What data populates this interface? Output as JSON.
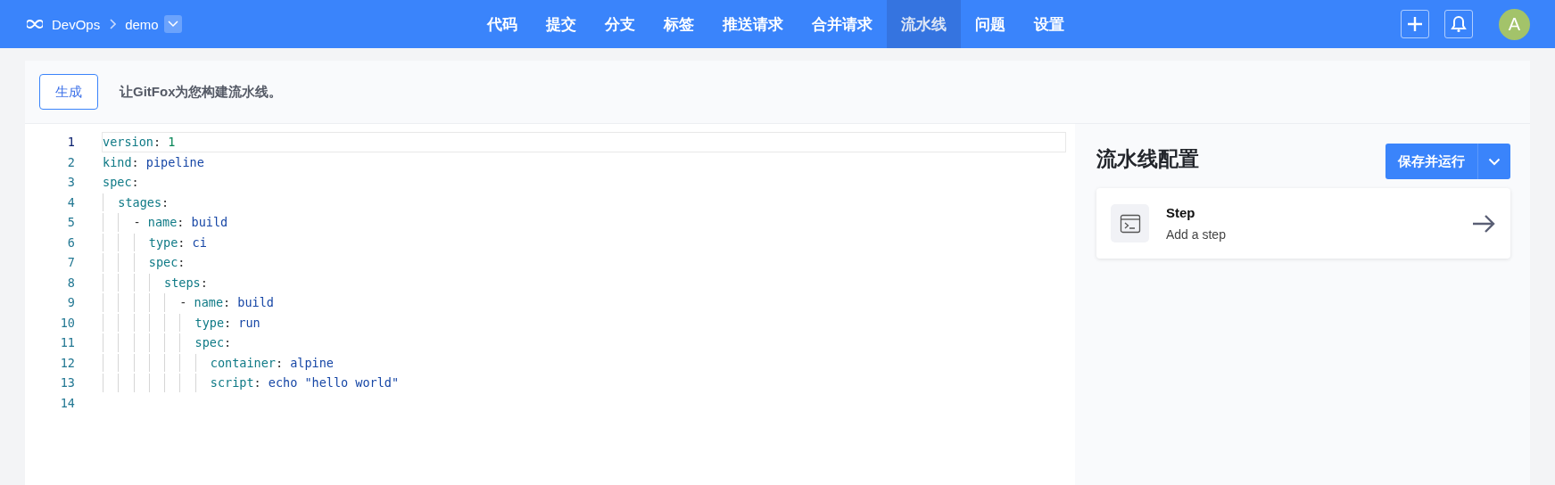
{
  "header": {
    "org": "DevOps",
    "repo": "demo",
    "nav": [
      {
        "label": "代码",
        "selected": false
      },
      {
        "label": "提交",
        "selected": false
      },
      {
        "label": "分支",
        "selected": false
      },
      {
        "label": "标签",
        "selected": false
      },
      {
        "label": "推送请求",
        "selected": false
      },
      {
        "label": "合并请求",
        "selected": false
      },
      {
        "label": "流水线",
        "selected": true
      },
      {
        "label": "问题",
        "selected": false
      },
      {
        "label": "设置",
        "selected": false
      }
    ],
    "avatar": "A"
  },
  "toolbar": {
    "button": "生成",
    "hint": "让GitFox为您构建流水线。"
  },
  "editor": {
    "lines": [
      {
        "number": "1",
        "active": true,
        "tokens": [
          {
            "kind": "key",
            "text": "version"
          },
          {
            "kind": "punct",
            "text": ": "
          },
          {
            "kind": "number",
            "text": "1"
          }
        ]
      },
      {
        "number": "2",
        "active": false,
        "tokens": [
          {
            "kind": "key",
            "text": "kind"
          },
          {
            "kind": "punct",
            "text": ": "
          },
          {
            "kind": "string",
            "text": "pipeline"
          }
        ]
      },
      {
        "number": "3",
        "active": false,
        "tokens": [
          {
            "kind": "key",
            "text": "spec"
          },
          {
            "kind": "punct",
            "text": ":"
          }
        ]
      },
      {
        "number": "4",
        "active": false,
        "tokens": [
          {
            "kind": "key",
            "text": "  stages"
          },
          {
            "kind": "punct",
            "text": ":"
          }
        ]
      },
      {
        "number": "5",
        "active": false,
        "tokens": [
          {
            "kind": "punct",
            "text": "    - "
          },
          {
            "kind": "key",
            "text": "name"
          },
          {
            "kind": "punct",
            "text": ": "
          },
          {
            "kind": "string",
            "text": "build"
          }
        ]
      },
      {
        "number": "6",
        "active": false,
        "tokens": [
          {
            "kind": "key",
            "text": "      type"
          },
          {
            "kind": "punct",
            "text": ": "
          },
          {
            "kind": "string",
            "text": "ci"
          }
        ]
      },
      {
        "number": "7",
        "active": false,
        "tokens": [
          {
            "kind": "key",
            "text": "      spec"
          },
          {
            "kind": "punct",
            "text": ":"
          }
        ]
      },
      {
        "number": "8",
        "active": false,
        "tokens": [
          {
            "kind": "key",
            "text": "        steps"
          },
          {
            "kind": "punct",
            "text": ":"
          }
        ]
      },
      {
        "number": "9",
        "active": false,
        "tokens": [
          {
            "kind": "punct",
            "text": "          - "
          },
          {
            "kind": "key",
            "text": "name"
          },
          {
            "kind": "punct",
            "text": ": "
          },
          {
            "kind": "string",
            "text": "build"
          }
        ]
      },
      {
        "number": "10",
        "active": false,
        "tokens": [
          {
            "kind": "key",
            "text": "            type"
          },
          {
            "kind": "punct",
            "text": ": "
          },
          {
            "kind": "string",
            "text": "run"
          }
        ]
      },
      {
        "number": "11",
        "active": false,
        "tokens": [
          {
            "kind": "key",
            "text": "            spec"
          },
          {
            "kind": "punct",
            "text": ":"
          }
        ]
      },
      {
        "number": "12",
        "active": false,
        "tokens": [
          {
            "kind": "key",
            "text": "              container"
          },
          {
            "kind": "punct",
            "text": ": "
          },
          {
            "kind": "string",
            "text": "alpine"
          }
        ]
      },
      {
        "number": "13",
        "active": false,
        "tokens": [
          {
            "kind": "key",
            "text": "              script"
          },
          {
            "kind": "punct",
            "text": ": "
          },
          {
            "kind": "string",
            "text": "echo \"hello world\""
          }
        ]
      },
      {
        "number": "14",
        "active": false
      }
    ]
  },
  "config": {
    "title": "流水线配置",
    "run_button": "保存并运行",
    "steps": [
      {
        "title": "Step",
        "subtitle": "Add a step"
      }
    ]
  }
}
